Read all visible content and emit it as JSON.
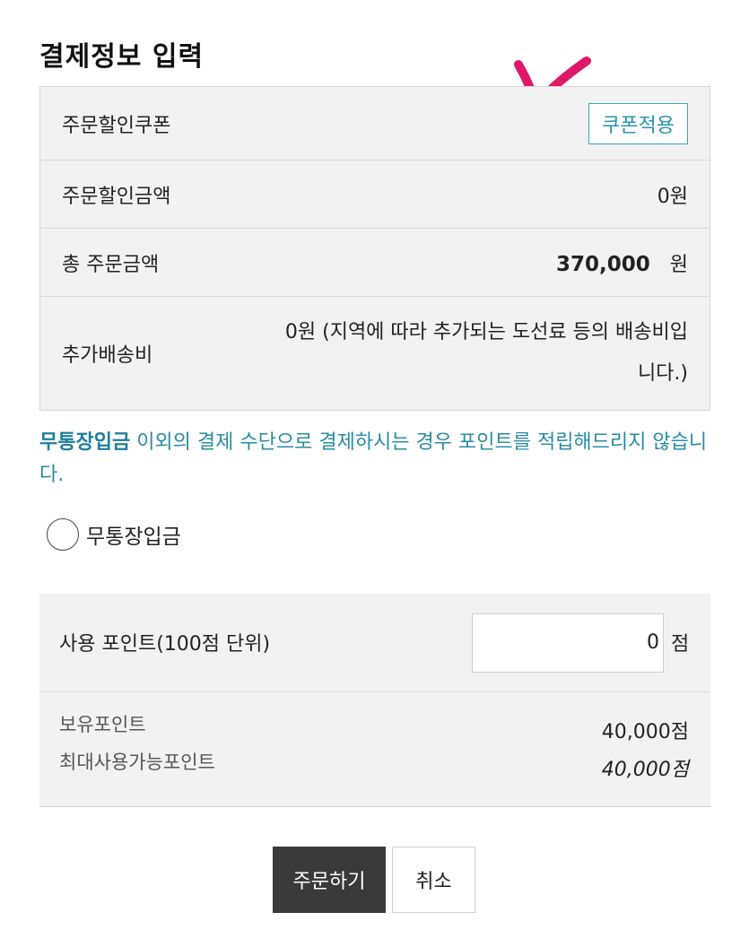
{
  "page": {
    "title": "결제정보 입력"
  },
  "annotation": {
    "mark": "check-mark",
    "color": "#e0186a"
  },
  "info_table": {
    "coupon_label": "주문할인쿠폰",
    "coupon_button": "쿠폰적용",
    "discount_label": "주문할인금액",
    "discount_value": "0원",
    "total_label": "총 주문금액",
    "total_amount": "370,000",
    "total_unit": "원",
    "shipping_label": "추가배송비",
    "shipping_note": "0원 (지역에 따라 추가되는 도선료 등의 배송비입니다.)"
  },
  "notice": {
    "highlight": "무통장입금",
    "text": " 이외의 결제 수단으로 결제하시는 경우 포인트를 적립해드리지 않습니다."
  },
  "payment_method": {
    "option_label": "무통장입금",
    "selected": false
  },
  "points": {
    "use_label": "사용 포인트(100점 단위)",
    "input_value": "0",
    "unit": "점",
    "have_label": "보유포인트",
    "have_value": "40,000점",
    "max_label": "최대사용가능포인트",
    "max_value": "40,000점"
  },
  "actions": {
    "order_button": "주문하기",
    "cancel_button": "취소"
  },
  "colors": {
    "accent": "#2a95ab",
    "dark_button": "#3a3a3a",
    "panel_bg": "#f2f2f2"
  }
}
